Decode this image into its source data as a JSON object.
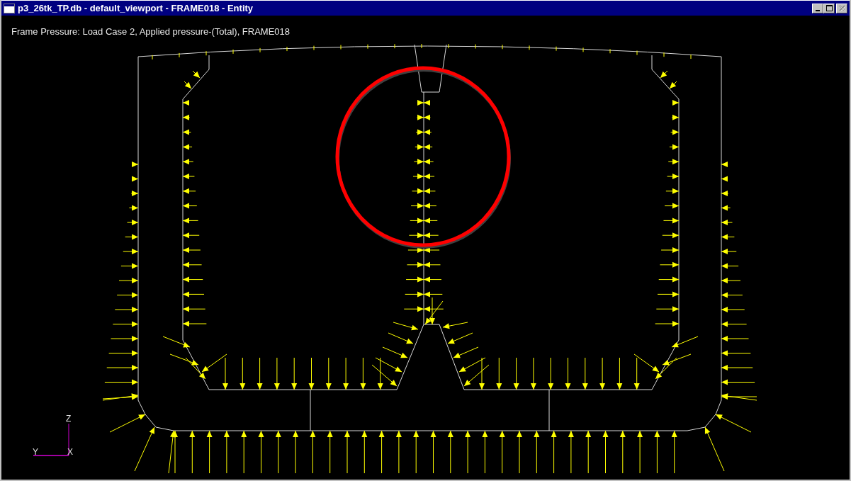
{
  "window": {
    "title": "p3_26tk_TP.db - default_viewport - FRAME018 - Entity",
    "controls": [
      {
        "kind": "minimize",
        "disabled": false
      },
      {
        "kind": "maximize",
        "disabled": false
      },
      {
        "kind": "close",
        "disabled": true
      }
    ]
  },
  "viewport": {
    "caption": "Frame Pressure: Load Case 2, Applied pressure-(Total), FRAME018",
    "axes": [
      {
        "kind": "z",
        "label": "Z"
      },
      {
        "kind": "y",
        "label": "Y"
      },
      {
        "kind": "x",
        "label": "X"
      }
    ],
    "highlight": {
      "color": "#ff0000"
    }
  }
}
